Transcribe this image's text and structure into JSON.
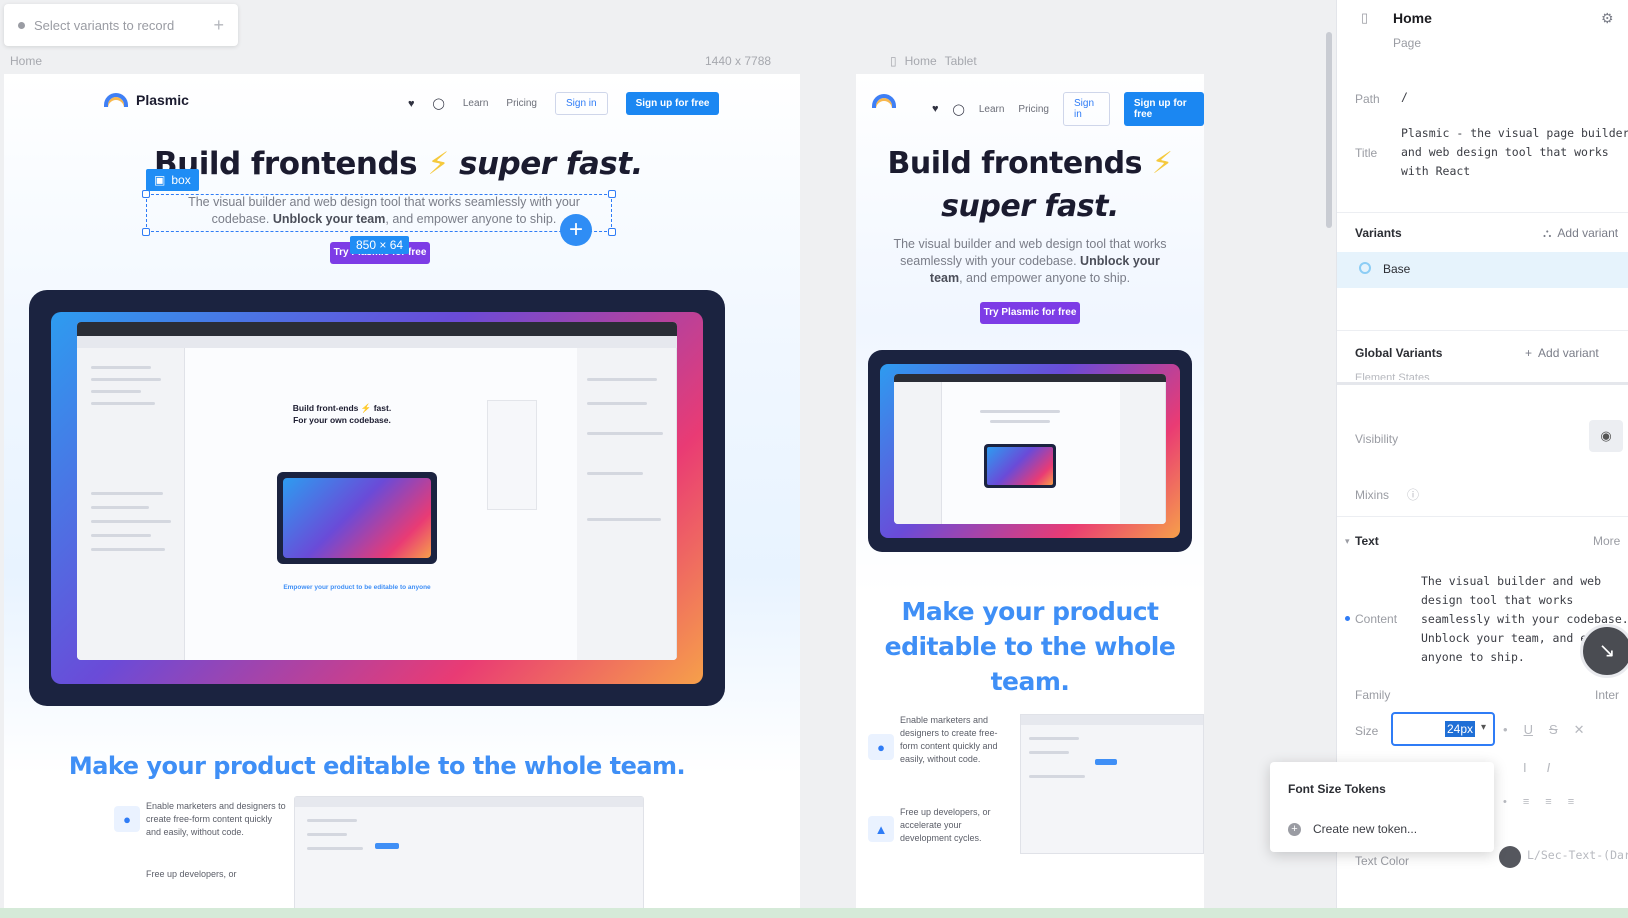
{
  "record_bar": {
    "label": "Select variants to record",
    "add": "+"
  },
  "desktop": {
    "frame_label": "Home",
    "frame_size": "1440 x 7788",
    "logo": "Plasmic",
    "nav": {
      "learn": "Learn",
      "pricing": "Pricing",
      "sign_in": "Sign in",
      "sign_up": "Sign up for free"
    },
    "hero_title_1": "Build frontends",
    "hero_title_2": "super fast.",
    "hero_sub_1": "The visual builder and web design tool that works seamlessly with your",
    "hero_sub_2": "codebase.",
    "hero_sub_bold": "Unblock your team",
    "hero_sub_3": ", and empower anyone to ship.",
    "cta": "Try Plasmic for free",
    "selection": {
      "tag": "box",
      "size": "850 × 64"
    },
    "section_title": "Make your product editable to the whole team.",
    "feature_1": "Enable marketers and designers to create free-form content quickly and easily, without code.",
    "feature_2": "Free up developers, or",
    "mini": {
      "title_1": "Build front-ends ⚡ fast.",
      "title_2": "For your own codebase.",
      "subtitle": "Empower your product to be editable to anyone"
    }
  },
  "tablet": {
    "frame_label_1": "Home",
    "frame_label_2": "Tablet",
    "nav": {
      "learn": "Learn",
      "pricing": "Pricing",
      "sign_in": "Sign in",
      "sign_up": "Sign up for free"
    },
    "hero_title_1": "Build frontends",
    "hero_title_2": "super fast.",
    "hero_sub_1": "The visual builder and web design tool that works",
    "hero_sub_2": "seamlessly with your codebase.",
    "hero_sub_bold_1": "Unblock your",
    "hero_sub_bold_2": "team",
    "hero_sub_3": ", and empower anyone to ship.",
    "cta": "Try Plasmic for free",
    "section_title": "Make your product editable to the whole team.",
    "feature_1": "Enable marketers and designers to create free-form content quickly and easily, without code.",
    "feature_2": "Free up developers, or accelerate your development cycles."
  },
  "panel": {
    "title": "Home",
    "subtitle": "Page",
    "path_label": "Path",
    "path_value": "/",
    "title_label": "Title",
    "title_value": "Plasmic - the visual page builder\nand web design tool that works\nwith React",
    "variants_label": "Variants",
    "add_variant": "Add variant",
    "base": "Base",
    "global_variants": "Global Variants",
    "add_global_variant": "Add variant",
    "element_states": "Element States",
    "visibility": "Visibility",
    "mixins": "Mixins",
    "text": "Text",
    "more": "More",
    "content_label": "Content",
    "content_value": "The visual builder and web\ndesign tool that works\nseamlessly with your codebase.\nUnblock your team, and empower\nanyone to ship.",
    "family_label": "Family",
    "family_value": "Inter",
    "size_label": "Size",
    "size_value": "24px",
    "font_size_tokens": "Font Size Tokens",
    "create_token": "Create new token...",
    "text_color_label": "Text Color",
    "text_color_value": "L/Sec-Text-(Dark)"
  },
  "colors": {
    "accent": "#1f8df5",
    "purple": "#7d3ce6",
    "section_blue": "#3f8ff6"
  }
}
